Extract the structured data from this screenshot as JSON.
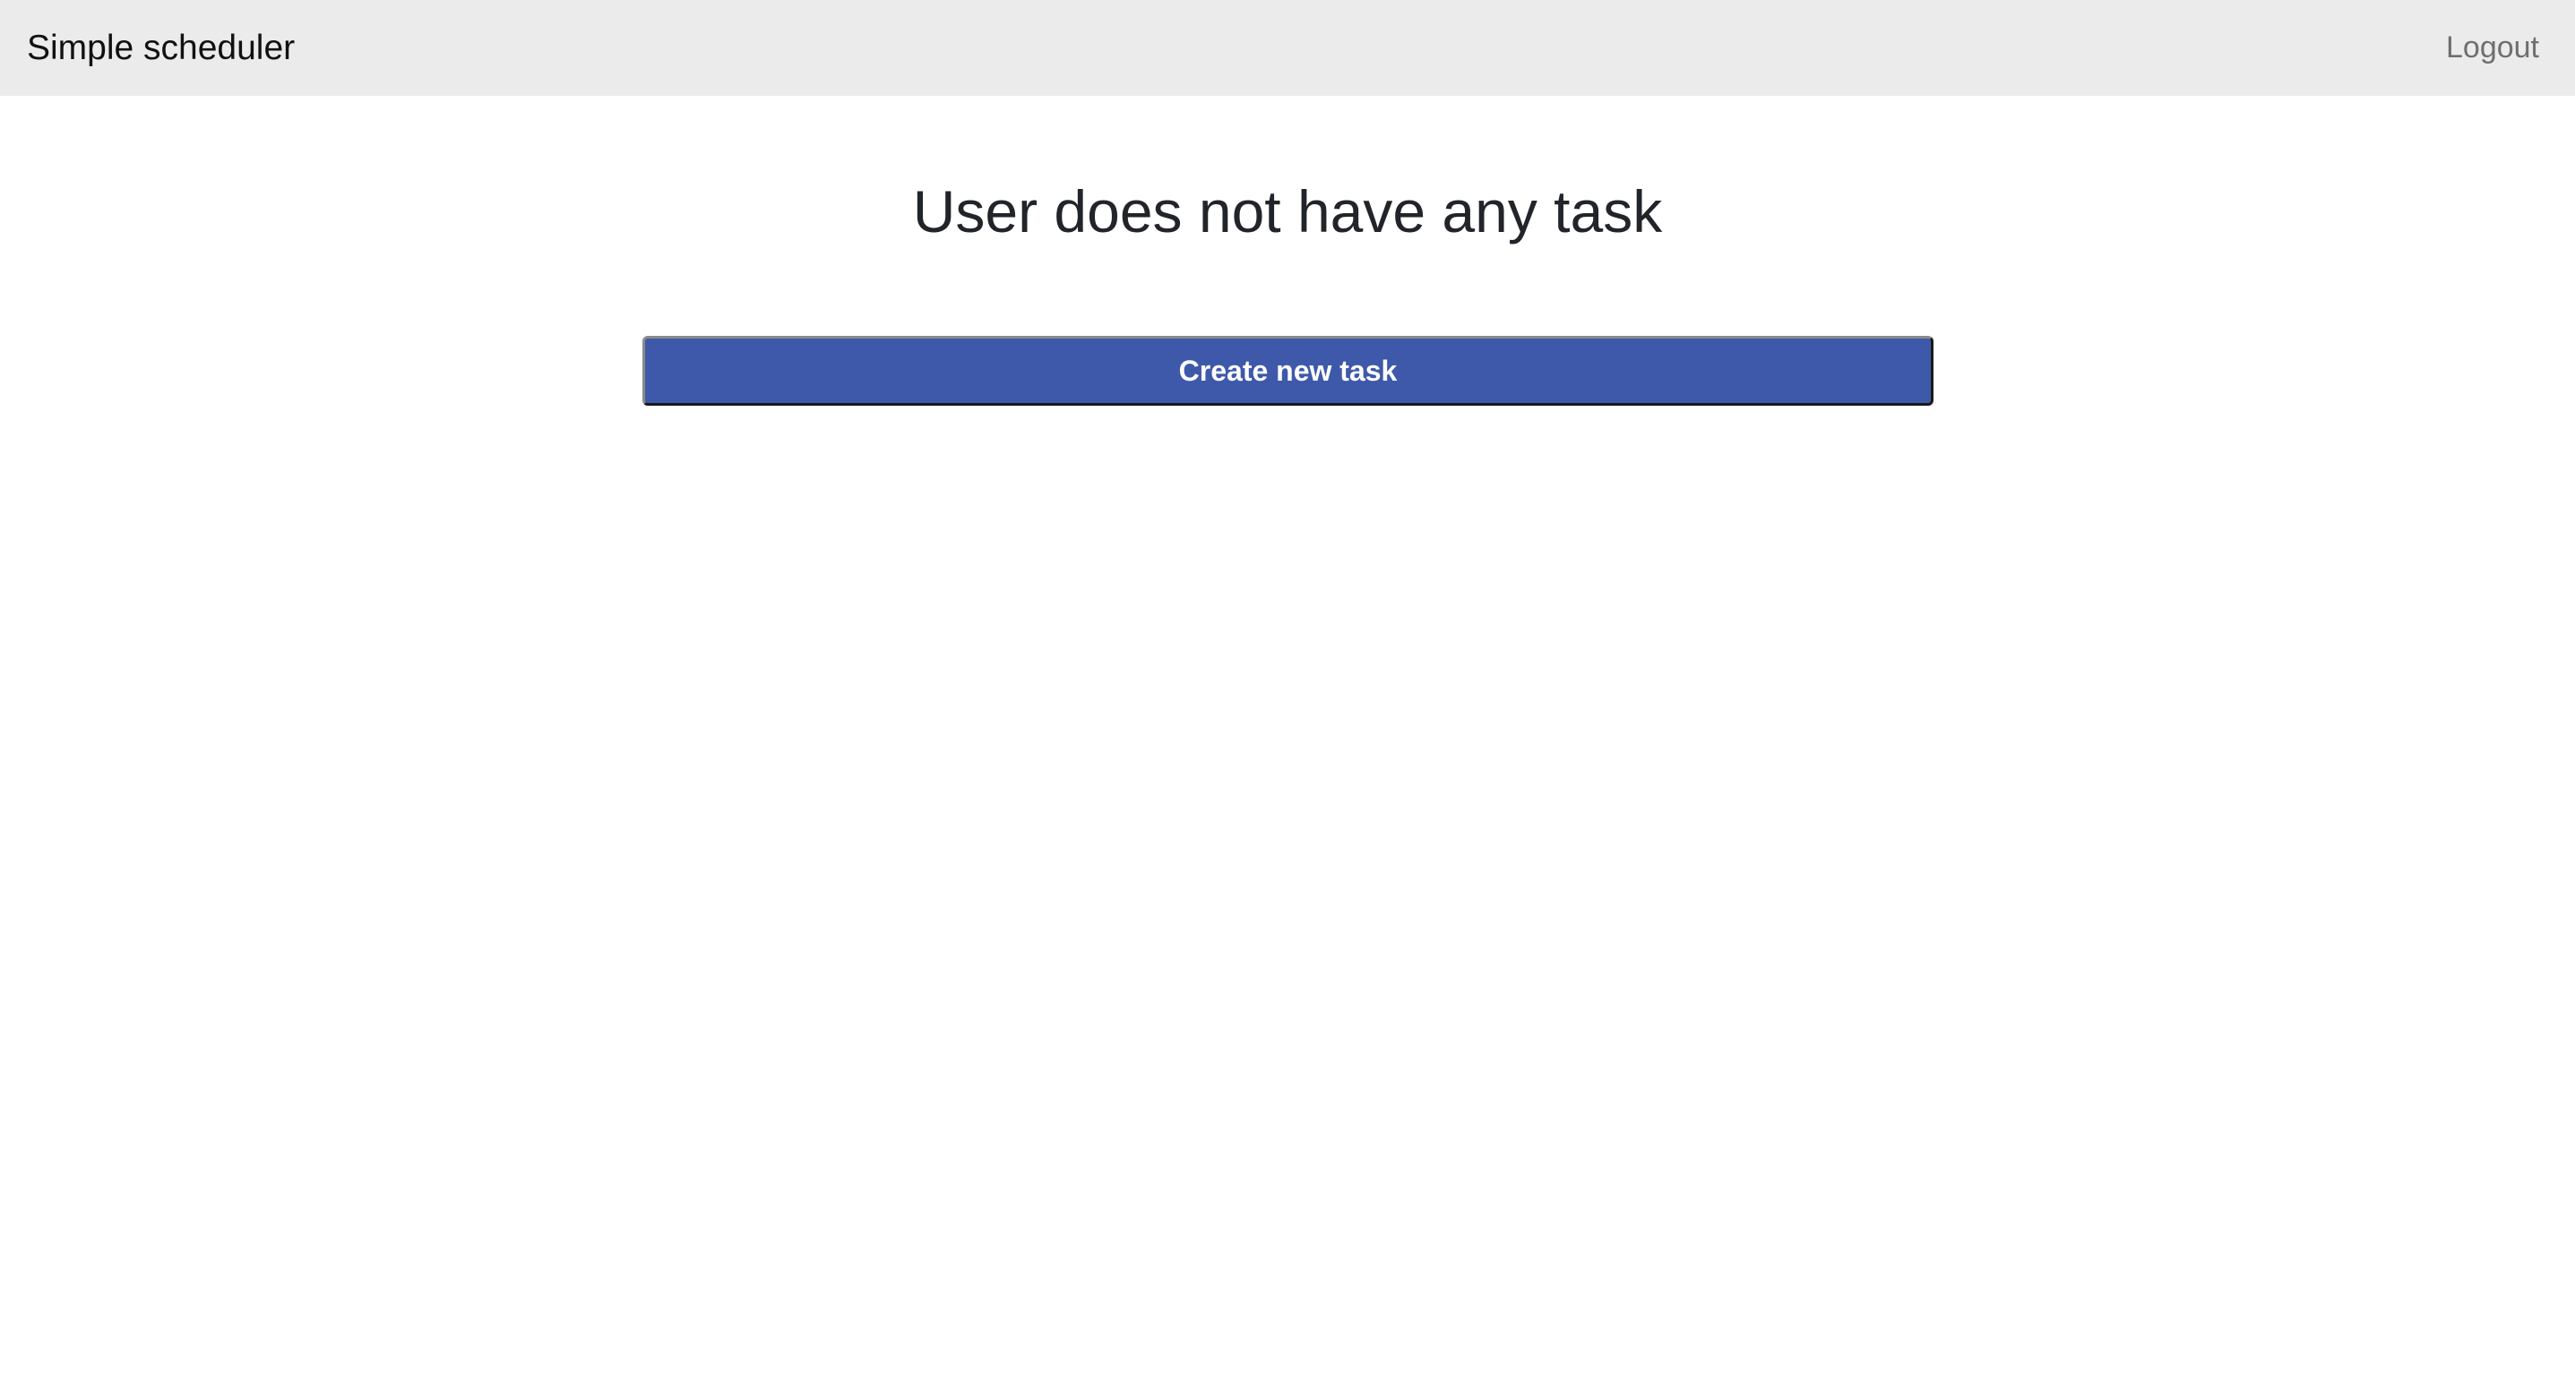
{
  "navbar": {
    "brand": "Simple scheduler",
    "logout_label": "Logout",
    "background_color": "#ebebeb"
  },
  "main": {
    "title": "User does not have any task",
    "create_button_label": "Create new task",
    "button_color": "#3e59aa"
  }
}
